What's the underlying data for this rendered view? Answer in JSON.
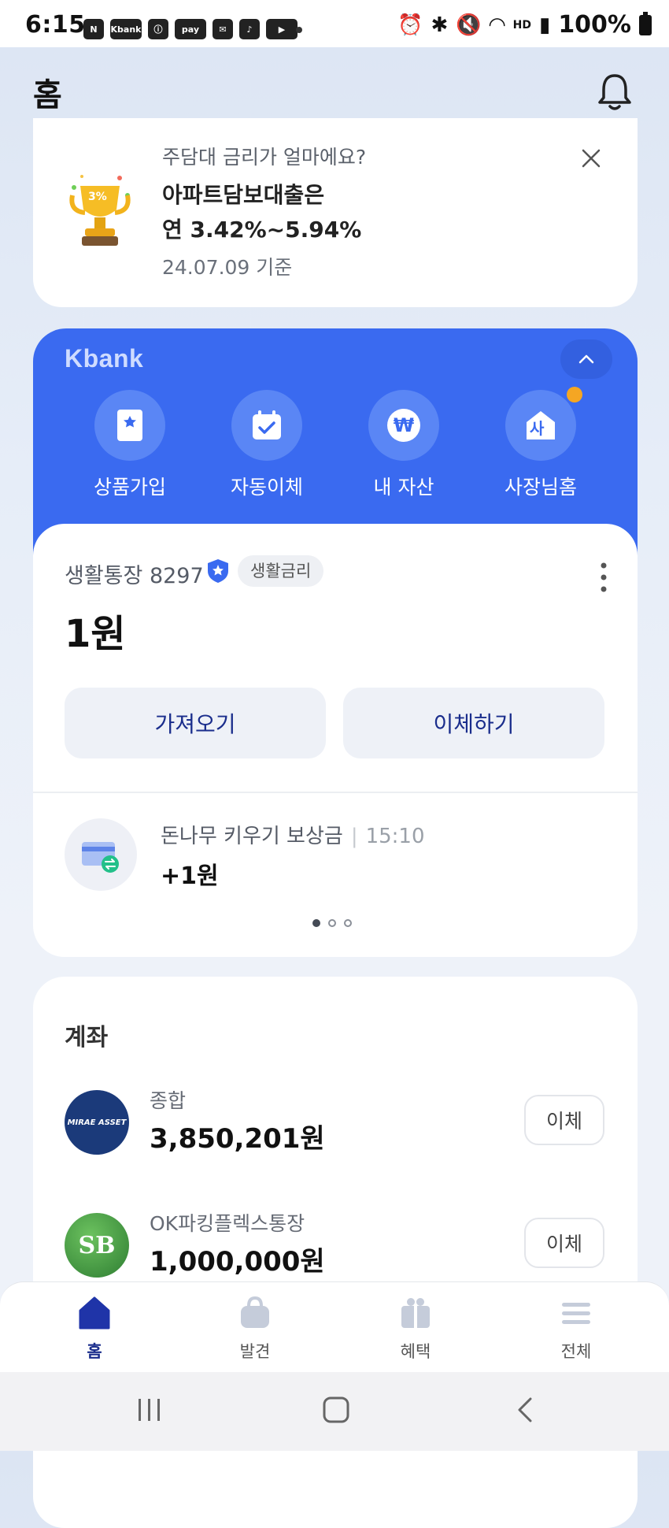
{
  "status_bar": {
    "time": "6:15",
    "left_icons": [
      "N",
      "Kbank",
      "ⓘ",
      "pay",
      "✉",
      "♪",
      "▶"
    ],
    "network_label": "HD",
    "battery": "100%"
  },
  "header": {
    "title": "홈"
  },
  "banner": {
    "question": "주담대 금리가 얼마에요?",
    "headline_line1": "아파트담보대출은",
    "headline_line2": "연 3.42%~5.94%",
    "date_note": "24.07.09 기준",
    "badge": "3%"
  },
  "kbank_panel": {
    "logo": "Kbank",
    "quick_actions": [
      {
        "label": "상품가입",
        "icon": "product-signup-icon"
      },
      {
        "label": "자동이체",
        "icon": "auto-transfer-icon"
      },
      {
        "label": "내 자산",
        "icon": "my-assets-icon",
        "glyph": "₩"
      },
      {
        "label": "사장님홈",
        "icon": "boss-home-icon",
        "glyph": "사"
      }
    ]
  },
  "account_card": {
    "account_name": "생활통장 8297",
    "tag": "생활금리",
    "balance": "1원",
    "buttons": {
      "bring": "가져오기",
      "transfer": "이체하기"
    },
    "recent": {
      "title": "돈나무 키우기 보상금",
      "time": "15:10",
      "amount": "+1원"
    }
  },
  "accounts": {
    "title": "계좌",
    "items": [
      {
        "name": "종합",
        "amount": "3,850,201원",
        "button": "이체",
        "logo_text": "MIRAE ASSET",
        "logo_color": "#1b3a7a"
      },
      {
        "name": "OK파킹플렉스통장",
        "amount": "1,000,000원",
        "button": "이체",
        "logo_text": "SB",
        "logo_color": "#3f9a3a"
      }
    ]
  },
  "bottom_nav": {
    "items": [
      {
        "label": "홈",
        "active": true
      },
      {
        "label": "발견",
        "active": false
      },
      {
        "label": "혜택",
        "active": false
      },
      {
        "label": "전체",
        "active": false
      }
    ]
  },
  "colors": {
    "brand_blue": "#3a6af0",
    "navy": "#1a2d8c",
    "notice_dot": "#f5a623"
  }
}
